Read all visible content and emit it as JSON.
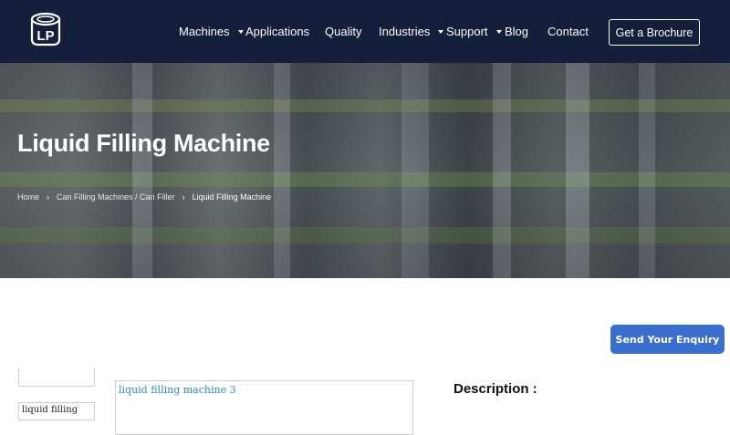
{
  "header": {
    "logo_text": "LP",
    "nav": [
      {
        "label": "Machines",
        "dropdown": true
      },
      {
        "label": "Applications",
        "dropdown": false
      },
      {
        "label": "Quality",
        "dropdown": false
      },
      {
        "label": "Industries",
        "dropdown": true
      },
      {
        "label": "Support",
        "dropdown": true
      },
      {
        "label": "Blog",
        "dropdown": false
      },
      {
        "label": "Contact",
        "dropdown": false
      }
    ],
    "brochure_label": "Get a Brochure"
  },
  "hero": {
    "title": "Liquid Filling Machine",
    "breadcrumb": {
      "home": "Home",
      "parent": "Can Filling Machines / Can Filler",
      "current": "Liquid Filling Machine"
    }
  },
  "enquiry_label": "Send Your Enquiry",
  "gallery": {
    "thumb2_alt": "liquid filling",
    "main_alt": "liquid filling machine 3"
  },
  "description_title": "Description :",
  "colors": {
    "header_bg": "#131f3b",
    "accent_button": "#3a6fcf",
    "link_alt_text": "#2a8bc5"
  }
}
